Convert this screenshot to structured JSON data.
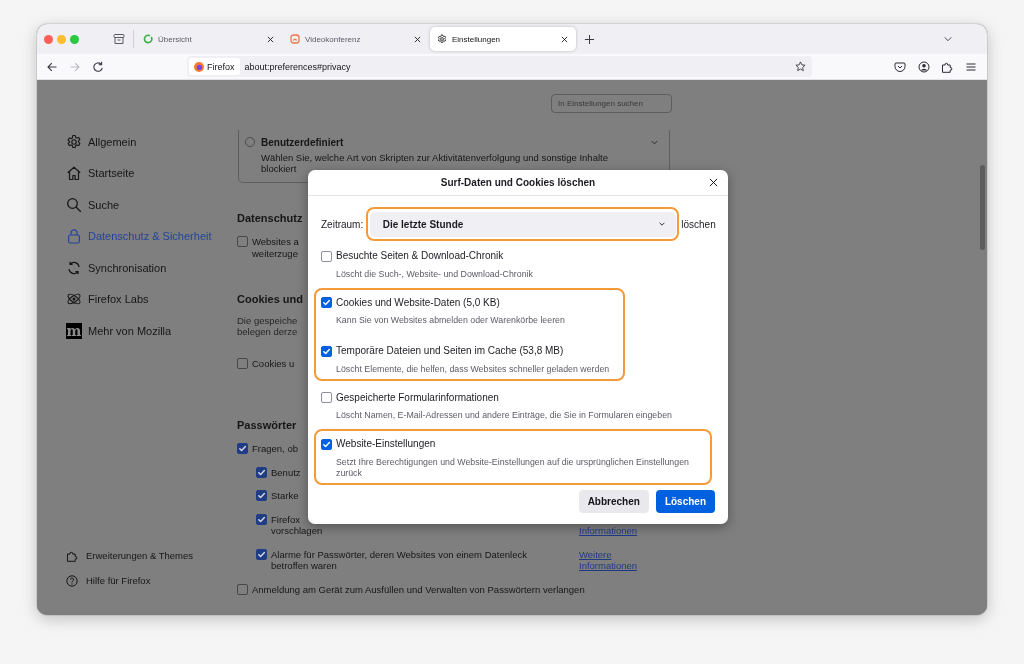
{
  "tabs": [
    {
      "title": "Übersicht",
      "selected": false
    },
    {
      "title": "Videokonferenz",
      "selected": false
    },
    {
      "title": "Einstellungen",
      "selected": true
    }
  ],
  "toolbar": {
    "buttons": [
      {
        "disabled": false
      },
      {
        "disabled": true
      },
      {
        "disabled": false
      }
    ],
    "identity": "Firefox",
    "url": "about:preferences#privacy"
  },
  "search": {
    "placeholder": "In Einstellungen suchen"
  },
  "sidebar": {
    "items": [
      {
        "label": "Allgemein",
        "selected": false
      },
      {
        "label": "Startseite",
        "selected": false
      },
      {
        "label": "Suche",
        "selected": false
      },
      {
        "label": "Datenschutz & Sicherheit",
        "selected": true
      },
      {
        "label": "Synchronisation",
        "selected": false
      },
      {
        "label": "Firefox Labs",
        "selected": false
      },
      {
        "label": "Mehr von Mozilla",
        "selected": false,
        "logo_letter": "m"
      }
    ],
    "footer_links": [
      "Erweiterungen & Themes",
      "Hilfe für Firefox"
    ]
  },
  "custom_block": {
    "title": "Benutzerdefiniert",
    "selected": false,
    "description_lines": [
      "Wählen Sie, welche Art von Skripten zur Aktivitätenverfolgung und sonstige Inhalte",
      "blockiert"
    ]
  },
  "sections": [
    {
      "heading": "Datenschutz",
      "rows": [
        {
          "checked": false,
          "lines": [
            "Websites a",
            "weiterzuge"
          ]
        }
      ]
    },
    {
      "heading": "Cookies und",
      "paragraph_lines": [
        "Die gespeiche",
        "belegen derze"
      ],
      "rows": [
        {
          "checked": false,
          "lines": [
            "Cookies u"
          ]
        }
      ]
    },
    {
      "heading": "Passwörter",
      "rows": [
        {
          "checked": true,
          "lines": [
            "Fragen, ob"
          ],
          "children": [
            {
              "checked": true,
              "lines": [
                "Benutz"
              ]
            },
            {
              "checked": true,
              "lines": [
                "Starke"
              ]
            },
            {
              "checked": true,
              "lines": [
                "Firefox",
                "vorschlagen"
              ],
              "link_lines": [
                "Informationen"
              ]
            },
            {
              "checked": true,
              "lines": [
                "Alarme für Passwörter, deren Websites von einem Datenleck",
                "betroffen waren"
              ],
              "link_lines": [
                "Weitere",
                "Informationen"
              ]
            }
          ]
        },
        {
          "checked": false,
          "lines": [
            "Anmeldung am Gerät zum Ausfüllen und Verwalten von Passwörtern verlangen"
          ]
        }
      ]
    }
  ],
  "dialog": {
    "title": "Surf-Daten und Cookies löschen",
    "range_label": "Zeitraum:",
    "range_value": "Die letzte Stunde",
    "range_highlighted": true,
    "range_suffix": "löschen",
    "groups": [
      {
        "highlighted": false,
        "items": [
          {
            "label": "Besuchte Seiten & Download-Chronik",
            "description": "Löscht die Such-, Website- und Download-Chronik",
            "checked": false
          }
        ]
      },
      {
        "highlighted": true,
        "items": [
          {
            "label": "Cookies und Website-Daten (5,0 KB)",
            "description": "Kann Sie von Websites abmelden oder Warenkörbe leeren",
            "checked": true
          },
          {
            "label": "Temporäre Dateien und Seiten im Cache (53,8 MB)",
            "description": "Löscht Elemente, die helfen, dass Websites schneller geladen werden",
            "checked": true
          }
        ]
      },
      {
        "highlighted": false,
        "items": [
          {
            "label": "Gespeicherte Formularinformationen",
            "description": "Löscht Namen, E-Mail-Adressen und andere Einträge, die Sie in Formularen eingeben",
            "checked": false
          }
        ]
      },
      {
        "highlighted": true,
        "items": [
          {
            "label": "Website-Einstellungen",
            "description": "Setzt Ihre Berechtigungen und Website-Einstellungen auf die ursprünglichen Einstellungen zurück",
            "checked": true
          }
        ]
      }
    ],
    "buttons": [
      {
        "label": "Abbrechen",
        "kind": "secondary"
      },
      {
        "label": "Löschen",
        "kind": "primary"
      }
    ]
  }
}
